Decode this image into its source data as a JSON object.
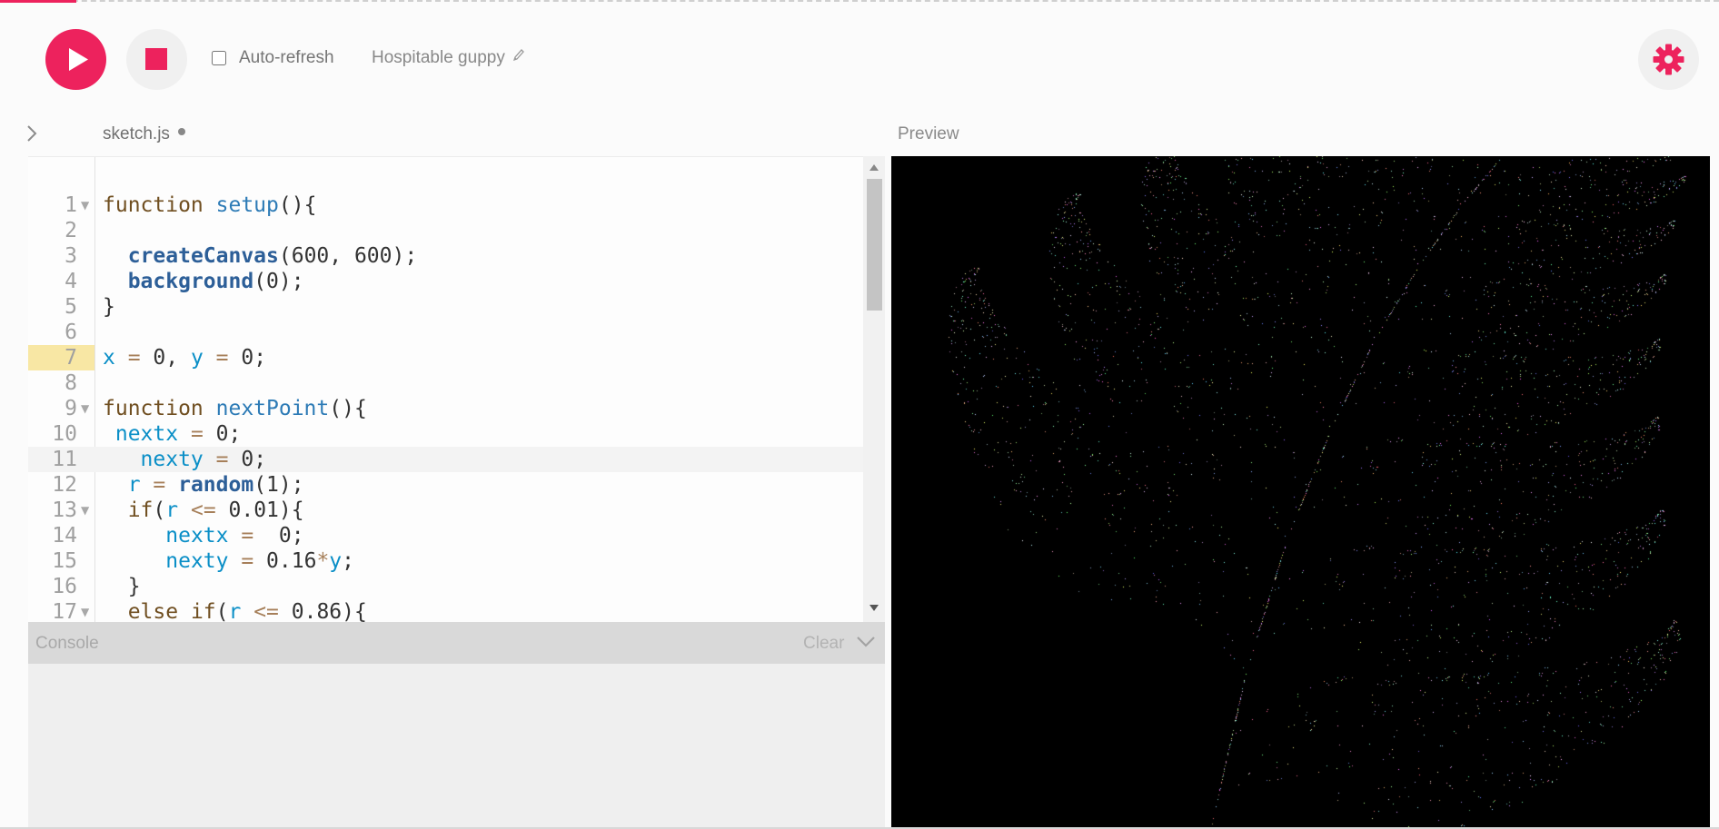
{
  "toolbar": {
    "play_label": "Run sketch",
    "stop_label": "Stop sketch",
    "autorefresh_label": "Auto-refresh",
    "autorefresh_checked": false,
    "project_name": "Hospitable guppy"
  },
  "editor": {
    "file_name": "sketch.js",
    "unsaved": true,
    "lines": [
      {
        "num": "1",
        "fold": true,
        "tokens": [
          [
            "kw",
            "function "
          ],
          [
            "fn",
            "setup"
          ],
          [
            "pun",
            "(){"
          ]
        ]
      },
      {
        "num": "2",
        "fold": false,
        "tokens": []
      },
      {
        "num": "3",
        "fold": false,
        "tokens": [
          [
            "pun",
            "  "
          ],
          [
            "bfn",
            "createCanvas"
          ],
          [
            "pun",
            "(600, 600);"
          ]
        ]
      },
      {
        "num": "4",
        "fold": false,
        "tokens": [
          [
            "pun",
            "  "
          ],
          [
            "bfn",
            "background"
          ],
          [
            "pun",
            "(0);"
          ]
        ]
      },
      {
        "num": "5",
        "fold": false,
        "tokens": [
          [
            "pun",
            "}"
          ]
        ]
      },
      {
        "num": "6",
        "fold": false,
        "tokens": []
      },
      {
        "num": "7",
        "fold": false,
        "marked": true,
        "tokens": [
          [
            "vr",
            "x"
          ],
          [
            "op",
            " = "
          ],
          [
            "num",
            "0"
          ],
          [
            "pun",
            ", "
          ],
          [
            "vr",
            "y"
          ],
          [
            "op",
            " = "
          ],
          [
            "num",
            "0"
          ],
          [
            "pun",
            ";"
          ]
        ]
      },
      {
        "num": "8",
        "fold": false,
        "tokens": []
      },
      {
        "num": "9",
        "fold": true,
        "tokens": [
          [
            "kw",
            "function "
          ],
          [
            "fn",
            "nextPoint"
          ],
          [
            "pun",
            "(){"
          ]
        ]
      },
      {
        "num": "10",
        "fold": false,
        "tokens": [
          [
            "pun",
            " "
          ],
          [
            "vr",
            "nextx"
          ],
          [
            "op",
            " = "
          ],
          [
            "num",
            "0"
          ],
          [
            "pun",
            ";"
          ]
        ]
      },
      {
        "num": "11",
        "fold": false,
        "active": true,
        "tokens": [
          [
            "pun",
            "   "
          ],
          [
            "vr",
            "nexty"
          ],
          [
            "op",
            " = "
          ],
          [
            "num",
            "0"
          ],
          [
            "pun",
            ";"
          ]
        ]
      },
      {
        "num": "12",
        "fold": false,
        "tokens": [
          [
            "pun",
            "  "
          ],
          [
            "vr",
            "r"
          ],
          [
            "op",
            " = "
          ],
          [
            "bfn",
            "random"
          ],
          [
            "pun",
            "(1);"
          ]
        ]
      },
      {
        "num": "13",
        "fold": true,
        "tokens": [
          [
            "pun",
            "  "
          ],
          [
            "kw",
            "if"
          ],
          [
            "pun",
            "("
          ],
          [
            "vr",
            "r"
          ],
          [
            "op",
            " <= "
          ],
          [
            "num",
            "0.01"
          ],
          [
            "pun",
            "){"
          ]
        ]
      },
      {
        "num": "14",
        "fold": false,
        "tokens": [
          [
            "pun",
            "     "
          ],
          [
            "vr",
            "nextx"
          ],
          [
            "op",
            " =  "
          ],
          [
            "num",
            "0"
          ],
          [
            "pun",
            ";"
          ]
        ]
      },
      {
        "num": "15",
        "fold": false,
        "tokens": [
          [
            "pun",
            "     "
          ],
          [
            "vr",
            "nexty"
          ],
          [
            "op",
            " = "
          ],
          [
            "num",
            "0.16"
          ],
          [
            "op",
            "*"
          ],
          [
            "vr",
            "y"
          ],
          [
            "pun",
            ";"
          ]
        ]
      },
      {
        "num": "16",
        "fold": false,
        "tokens": [
          [
            "pun",
            "  }"
          ]
        ]
      },
      {
        "num": "17",
        "fold": true,
        "tokens": [
          [
            "pun",
            "  "
          ],
          [
            "kw",
            "else if"
          ],
          [
            "pun",
            "("
          ],
          [
            "vr",
            "r"
          ],
          [
            "op",
            " <= "
          ],
          [
            "num",
            "0.86"
          ],
          [
            "pun",
            "){"
          ]
        ]
      }
    ]
  },
  "console": {
    "title": "Console",
    "clear_label": "Clear"
  },
  "preview": {
    "title": "Preview",
    "background_color": "#000000",
    "content": "barnsley-fern"
  },
  "colors": {
    "accent": "#ed225d",
    "keyword": "#704f21",
    "function": "#2d7bb6",
    "variable": "#0b8fc7",
    "operator": "#a67f59",
    "line_marker": "#f8e7a4"
  },
  "icons": {
    "play": "play-icon",
    "stop": "stop-icon",
    "settings": "gear-icon",
    "edit_name": "pencil-icon",
    "sidebar": "chevron-right-icon",
    "console_toggle": "chevron-down-icon"
  }
}
